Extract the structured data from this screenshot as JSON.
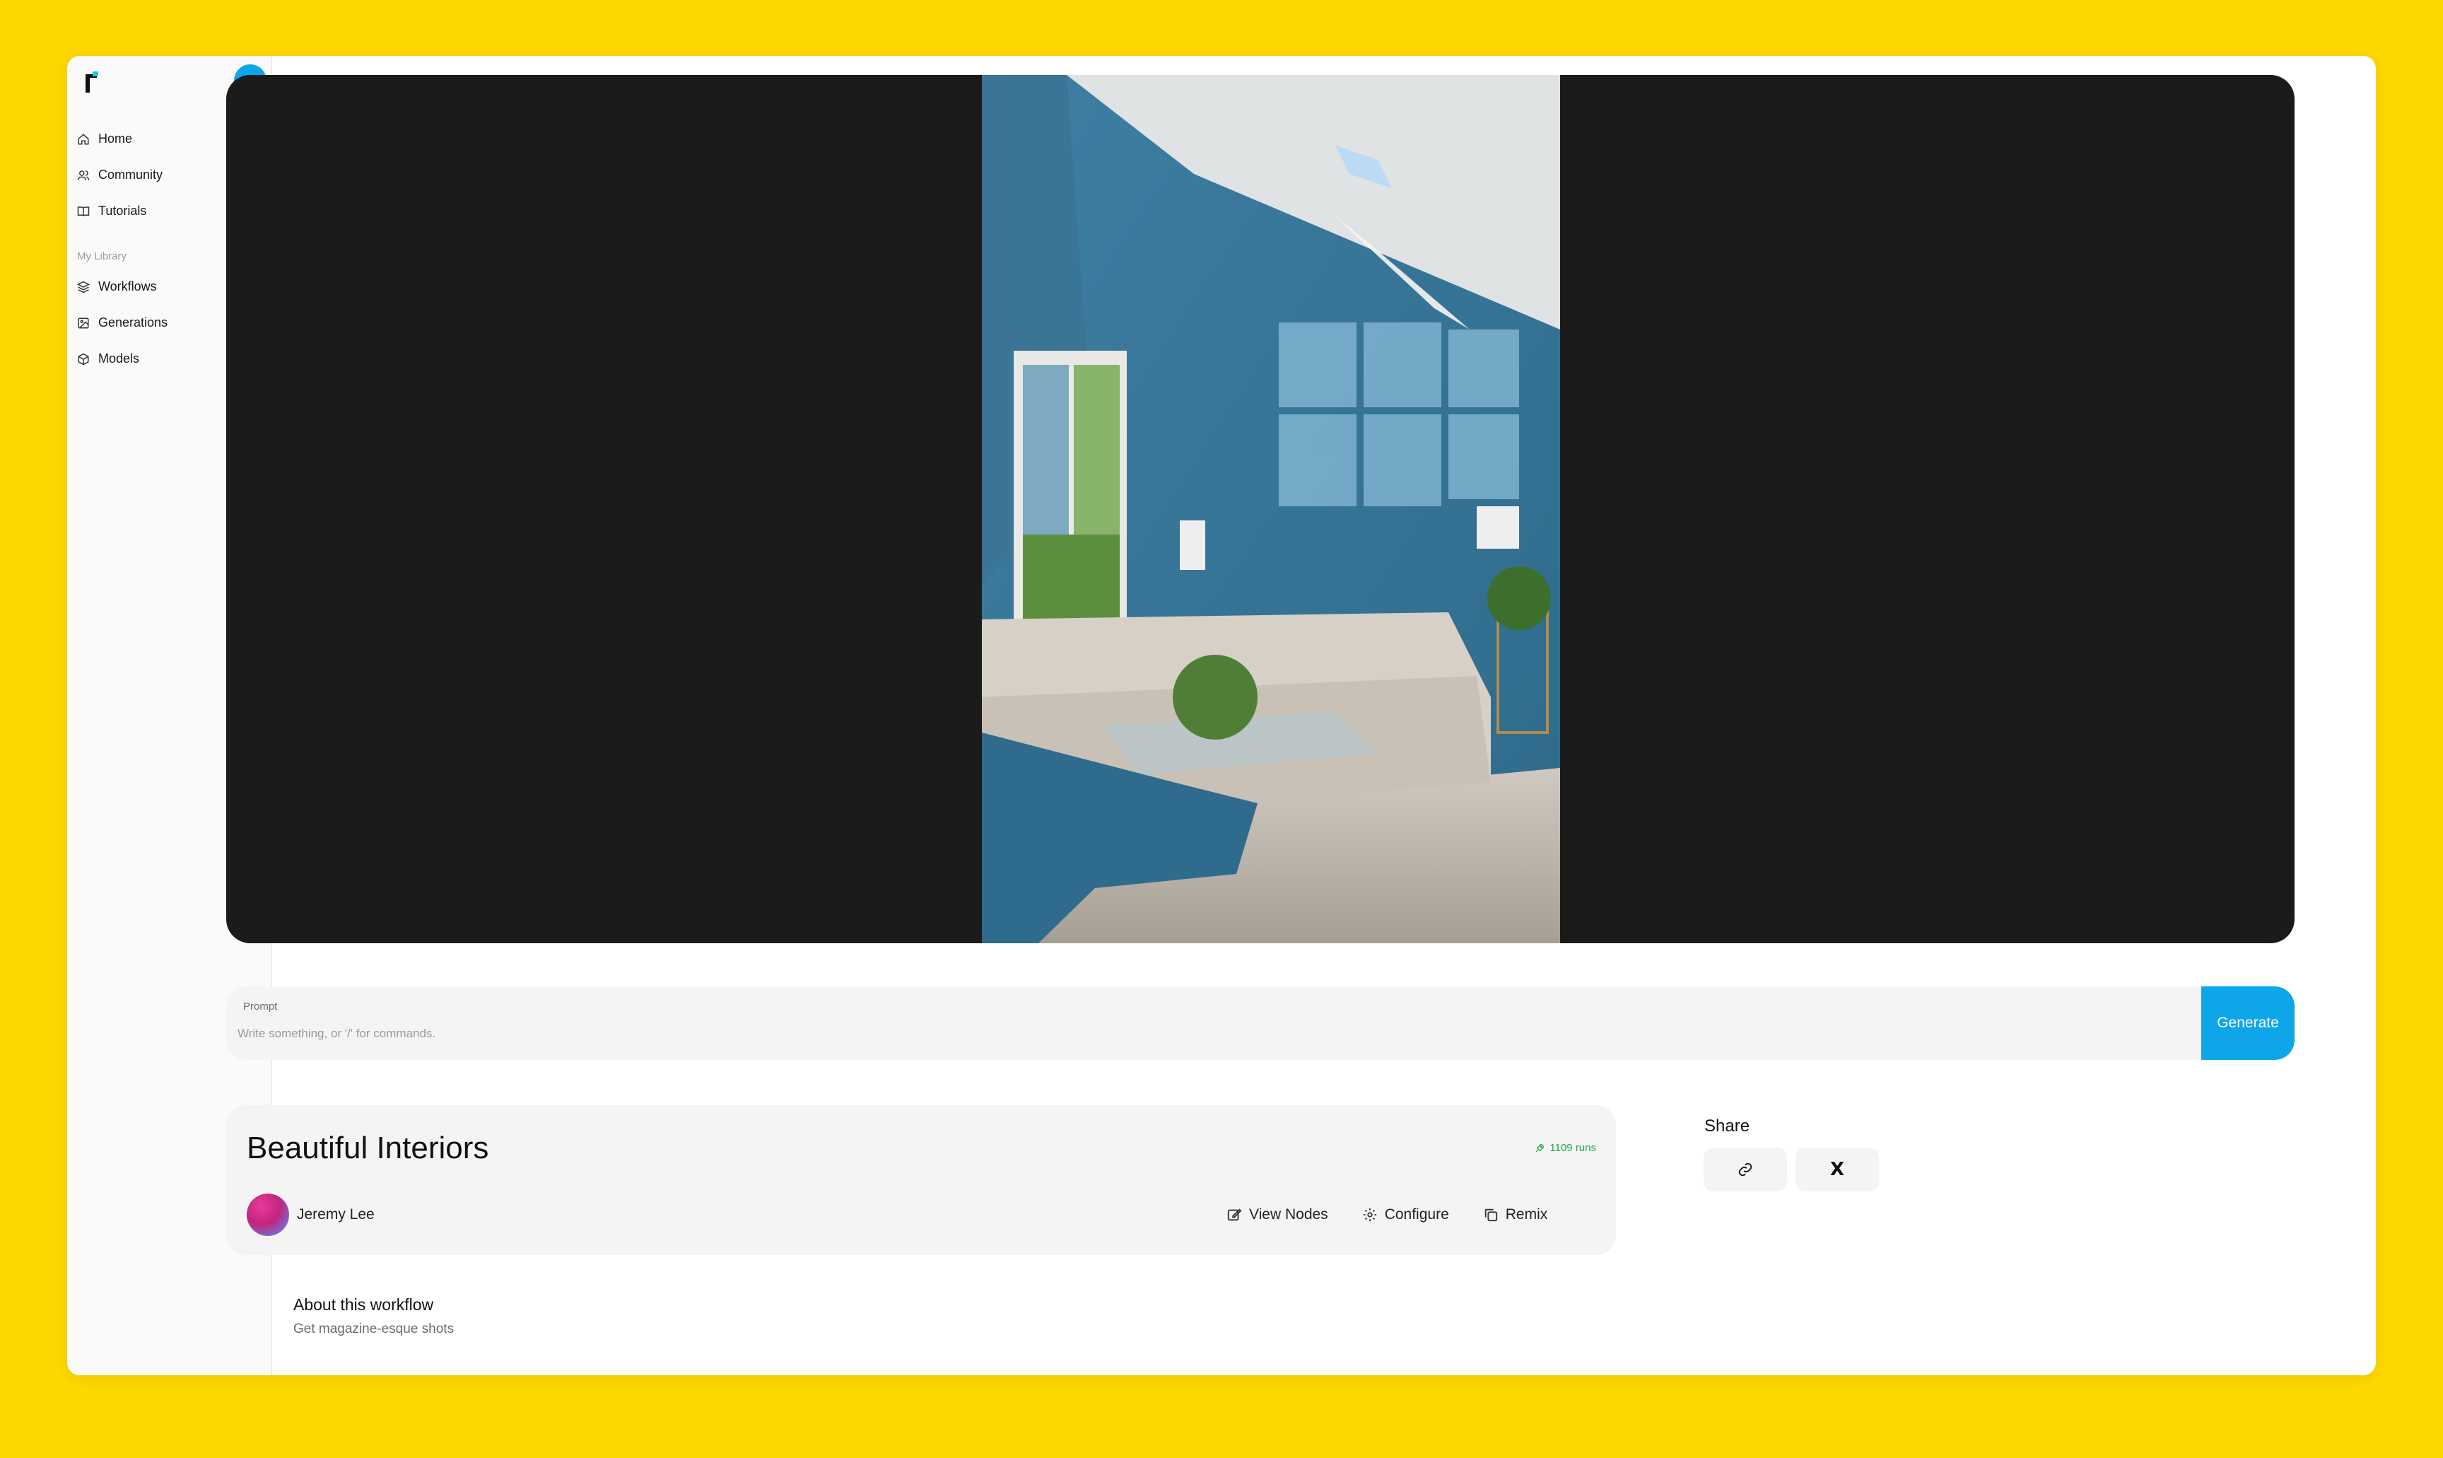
{
  "sidebar": {
    "new_button": "+",
    "nav": [
      {
        "label": "Home",
        "icon": "home-icon"
      },
      {
        "label": "Community",
        "icon": "users-icon"
      },
      {
        "label": "Tutorials",
        "icon": "book-icon"
      }
    ],
    "library_label": "My Library",
    "library": [
      {
        "label": "Workflows",
        "icon": "layers-icon"
      },
      {
        "label": "Generations",
        "icon": "image-icon"
      },
      {
        "label": "Models",
        "icon": "cube-icon"
      }
    ]
  },
  "viewer": {
    "upload_icon": "upload-icon"
  },
  "prompt": {
    "label": "Prompt",
    "placeholder": "Write something, or '/' for commands.",
    "value": "",
    "generate_label": "Generate"
  },
  "workflow": {
    "title": "Beautiful Interiors",
    "runs": "1109 runs",
    "author": "Jeremy Lee",
    "actions": {
      "view_nodes": "View Nodes",
      "configure": "Configure",
      "remix": "Remix"
    }
  },
  "share": {
    "label": "Share",
    "x_label": "X"
  },
  "about": {
    "title": "About this workflow",
    "description": "Get magazine-esque shots"
  },
  "colors": {
    "background": "#FFD700",
    "accent": "#0ea5e9",
    "runs": "#22a34a"
  }
}
